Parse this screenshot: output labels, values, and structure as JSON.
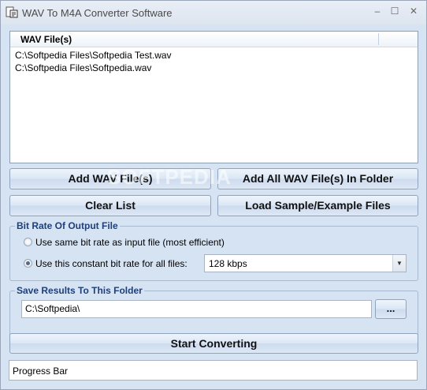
{
  "window": {
    "title": "WAV To M4A Converter Software",
    "controls": {
      "minimize": "–",
      "maximize": "☐",
      "close": "✕"
    }
  },
  "file_list": {
    "header": "WAV File(s)",
    "items": [
      "C:\\Softpedia Files\\Softpedia Test.wav",
      "C:\\Softpedia Files\\Softpedia.wav"
    ]
  },
  "buttons": {
    "add_files": "Add WAV File(s)",
    "add_folder": "Add All WAV File(s) In Folder",
    "clear_list": "Clear List",
    "load_samples": "Load Sample/Example Files",
    "browse": "...",
    "start": "Start Converting"
  },
  "watermark": "SOFTPEDIA",
  "bitrate": {
    "group_title": "Bit Rate Of Output File",
    "option_same": "Use same bit rate as input file (most efficient)",
    "option_constant": "Use this constant bit rate for all files:",
    "selected_option": "constant",
    "value": "128 kbps"
  },
  "output": {
    "group_title": "Save Results To This Folder",
    "folder": "C:\\Softpedia\\"
  },
  "progress": {
    "label": "Progress Bar"
  },
  "colors": {
    "client_background": "#d6e3f2",
    "group_title": "#1f3f7a"
  }
}
